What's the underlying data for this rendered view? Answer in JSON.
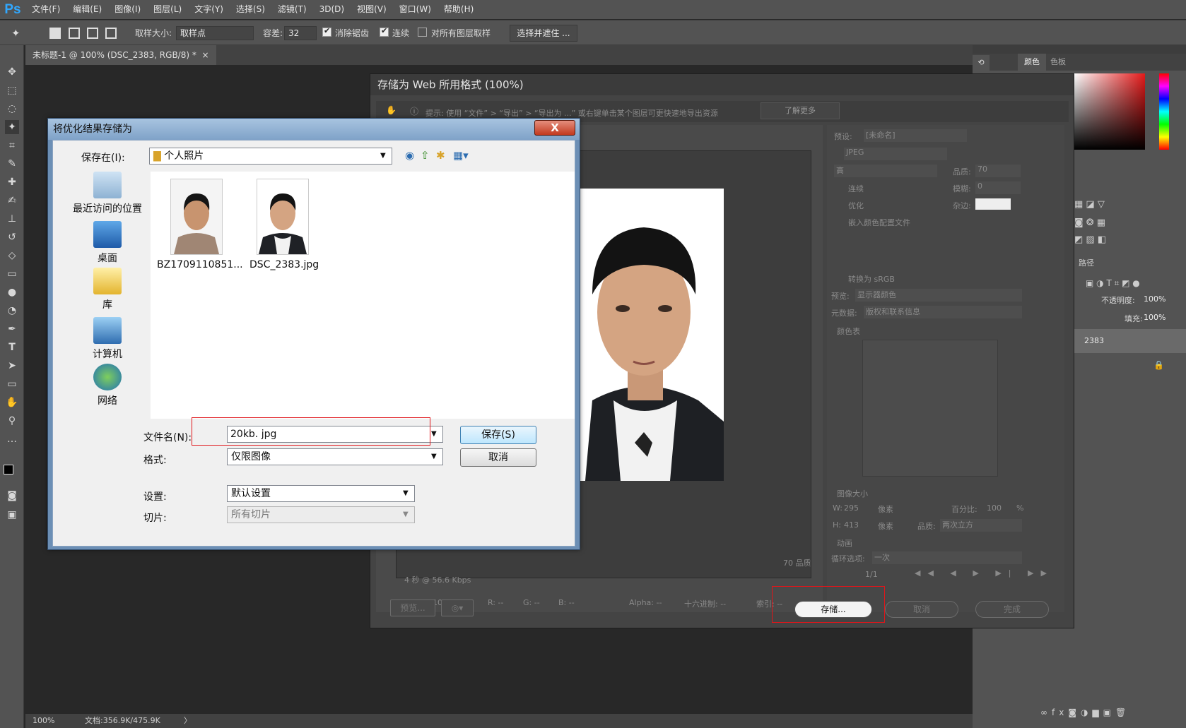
{
  "app": {
    "logo": "Ps",
    "menu": [
      "文件(F)",
      "编辑(E)",
      "图像(I)",
      "图层(L)",
      "文字(Y)",
      "选择(S)",
      "滤镜(T)",
      "3D(D)",
      "视图(V)",
      "窗口(W)",
      "帮助(H)"
    ]
  },
  "options": {
    "sample_size_label": "取样大小:",
    "sample_size_value": "取样点",
    "tolerance_label": "容差:",
    "tolerance_value": "32",
    "antialias": "消除锯齿",
    "contiguous": "连续",
    "sample_all": "对所有图层取样",
    "select_mask": "选择并遮住 ..."
  },
  "document": {
    "tab": "未标题-1 @ 100% (DSC_2383, RGB/8) *",
    "close": "×"
  },
  "status": {
    "zoom": "100%",
    "doc": "文档:356.9K/475.9K",
    "arrow": "〉"
  },
  "right_panel": {
    "history": "历史记录",
    "color": "颜色",
    "swatches": "色板",
    "paths": "路径",
    "opacity_label": "不透明度:",
    "opacity": "100%",
    "fill_label": "填充:",
    "fill": "100%",
    "layer": "2383"
  },
  "save_for_web": {
    "title": "存储为 Web 所用格式 (100%)",
    "hint": "提示: 使用 “文件” > “导出” > “导出为 ...” 或右键单击某个图层可更快速地导出资源",
    "learn_more": "了解更多",
    "preset_label": "预设:",
    "preset": "[未命名]",
    "format": "JPEG",
    "quality_level": "高",
    "quality_label": "品质:",
    "quality": "70",
    "progressive": "连续",
    "blur_label": "模糊:",
    "blur": "0",
    "optimized": "优化",
    "matte_label": "杂边:",
    "embed_profile": "嵌入颜色配置文件",
    "convert_srgb": "转换为 sRGB",
    "preview_label": "预览:",
    "preview": "显示器颜色",
    "metadata_label": "元数据:",
    "metadata": "版权和联系信息",
    "color_table": "颜色表",
    "image_size": "图像大小",
    "w_label": "W:",
    "w": "295",
    "h_label": "H:",
    "h": "413",
    "px": "像素",
    "percent_label": "百分比:",
    "percent": "100",
    "percent_unit": "%",
    "resample_label": "品质:",
    "resample": "两次立方",
    "animation": "动画",
    "loop_label": "循环选项:",
    "loop": "一次",
    "frame": "1/1",
    "quality_text": "70 品质",
    "speed": "4 秒 @ 56.6 Kbps",
    "zoom": "100%",
    "r": "R: --",
    "g": "G: --",
    "b": "B: --",
    "alpha": "Alpha: --",
    "hex": "十六进制: --",
    "index": "索引: --",
    "preview_btn": "预览...",
    "save_btn": "存储...",
    "cancel_btn": "取消",
    "done_btn": "完成"
  },
  "dialog": {
    "title": "将优化结果存储为",
    "close": "X",
    "save_in_label": "保存在(I):",
    "save_in": "个人照片",
    "places": [
      "最近访问的位置",
      "桌面",
      "库",
      "计算机",
      "网络"
    ],
    "files": [
      {
        "name": "BZ1709110851..."
      },
      {
        "name": "DSC_2383.jpg"
      }
    ],
    "filename_label": "文件名(N):",
    "filename": "20kb. jpg",
    "format_label": "格式:",
    "format": "仅限图像",
    "settings_label": "设置:",
    "settings": "默认设置",
    "slices_label": "切片:",
    "slices": "所有切片",
    "save": "保存(S)",
    "cancel": "取消"
  }
}
